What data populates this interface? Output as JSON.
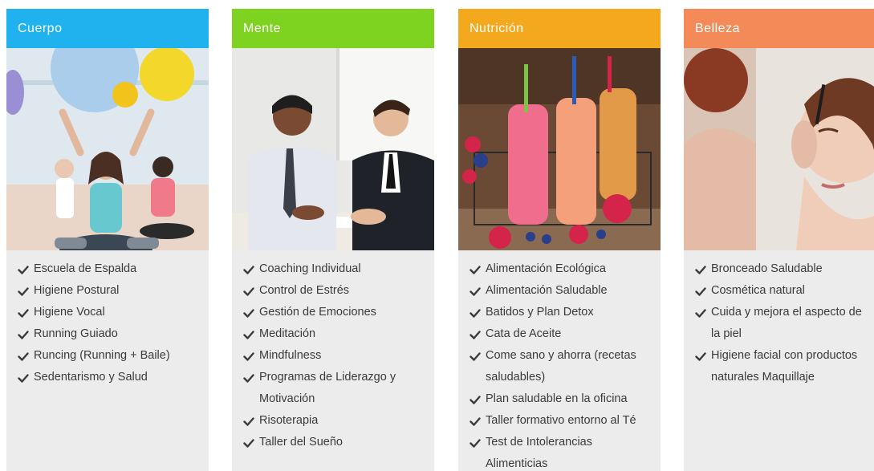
{
  "cards": [
    {
      "title": "Cuerpo",
      "color": "#1fb2ef",
      "image": "fitness-class-image",
      "items": [
        "Escuela de Espalda",
        "Higiene Postural",
        "Higiene Vocal",
        "Running Guiado",
        "Runcing (Running + Baile)",
        "Sedentarismo y Salud"
      ]
    },
    {
      "title": "Mente",
      "color": "#7ed321",
      "image": "business-meeting-image",
      "items": [
        "Coaching Individual",
        "Control de Estrés",
        "Gestión de Emociones",
        "Meditación",
        "Mindfulness",
        "Programas de Liderazgo y Motivación",
        "Risoterapia",
        "Taller del Sueño"
      ]
    },
    {
      "title": "Nutrición",
      "color": "#f4a81d",
      "image": "smoothies-image",
      "items": [
        "Alimentación Ecológica",
        "Alimentación Saludable",
        "Batidos y Plan Detox",
        "Cata de Aceite",
        "Come sano y ahorra (recetas saludables)",
        "Plan saludable en la oficina",
        "Taller formativo entorno al Té",
        "Test de Intolerancias Alimenticias"
      ]
    },
    {
      "title": "Belleza",
      "color": "#f48a57",
      "image": "makeup-image",
      "items": [
        "Bronceado Saludable",
        "Cosmética natural",
        "Cuida y mejora el aspecto de la piel",
        "Higiene facial con productos naturales Maquillaje"
      ]
    }
  ],
  "icons": {
    "bullet": "check-icon"
  }
}
